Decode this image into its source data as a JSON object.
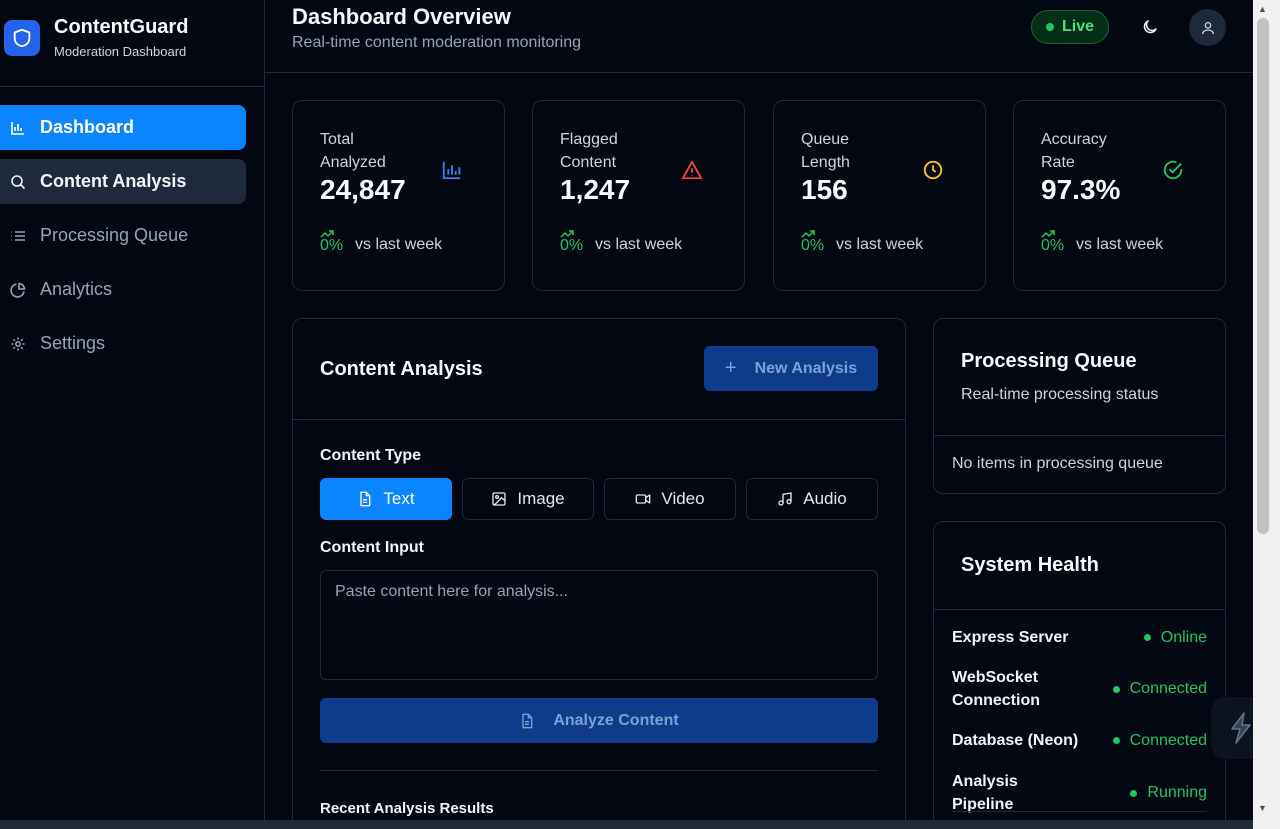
{
  "brand": {
    "title": "ContentGuard",
    "subtitle": "Moderation Dashboard"
  },
  "sidebar": {
    "items": [
      {
        "label": "Dashboard",
        "icon": "bar-chart-icon",
        "state": "active"
      },
      {
        "label": "Content Analysis",
        "icon": "search-icon",
        "state": "hover"
      },
      {
        "label": "Processing Queue",
        "icon": "list-icon",
        "state": ""
      },
      {
        "label": "Analytics",
        "icon": "pie-chart-icon",
        "state": ""
      },
      {
        "label": "Settings",
        "icon": "gear-icon",
        "state": ""
      }
    ]
  },
  "header": {
    "title": "Dashboard Overview",
    "subtitle": "Real-time content moderation monitoring",
    "live_label": "Live"
  },
  "stats": [
    {
      "label": "Total Analyzed",
      "value": "24,847",
      "change": "0%",
      "compare": "vs last week",
      "icon": "bar-chart-icon",
      "color": "#3b82f6"
    },
    {
      "label": "Flagged Content",
      "value": "1,247",
      "change": "0%",
      "compare": "vs last week",
      "icon": "warning-icon",
      "color": "#ef4444"
    },
    {
      "label": "Queue Length",
      "value": "156",
      "change": "0%",
      "compare": "vs last week",
      "icon": "clock-icon",
      "color": "#facc15"
    },
    {
      "label": "Accuracy Rate",
      "value": "97.3%",
      "change": "0%",
      "compare": "vs last week",
      "icon": "check-circle-icon",
      "color": "#22c55e"
    }
  ],
  "analysis": {
    "title": "Content Analysis",
    "new_button": "New Analysis",
    "content_type_label": "Content Type",
    "types": [
      {
        "label": "Text",
        "icon": "document-icon",
        "active": true
      },
      {
        "label": "Image",
        "icon": "image-icon",
        "active": false
      },
      {
        "label": "Video",
        "icon": "video-icon",
        "active": false
      },
      {
        "label": "Audio",
        "icon": "music-icon",
        "active": false
      }
    ],
    "input_label": "Content Input",
    "input_placeholder": "Paste content here for analysis...",
    "input_value": "",
    "analyze_button": "Analyze Content",
    "recent_title": "Recent Analysis Results"
  },
  "queue": {
    "title": "Processing Queue",
    "subtitle": "Real-time processing status",
    "empty_text": "No items in processing queue"
  },
  "health": {
    "title": "System Health",
    "items": [
      {
        "name": "Express Server",
        "status": "Online"
      },
      {
        "name": "WebSocket Connection",
        "status": "Connected"
      },
      {
        "name": "Database (Neon)",
        "status": "Connected"
      },
      {
        "name": "Analysis Pipeline",
        "status": "Running"
      }
    ]
  },
  "colors": {
    "accent": "#0a84ff",
    "success": "#22c55e",
    "danger": "#ef4444",
    "warning": "#facc15",
    "background": "#030712"
  }
}
